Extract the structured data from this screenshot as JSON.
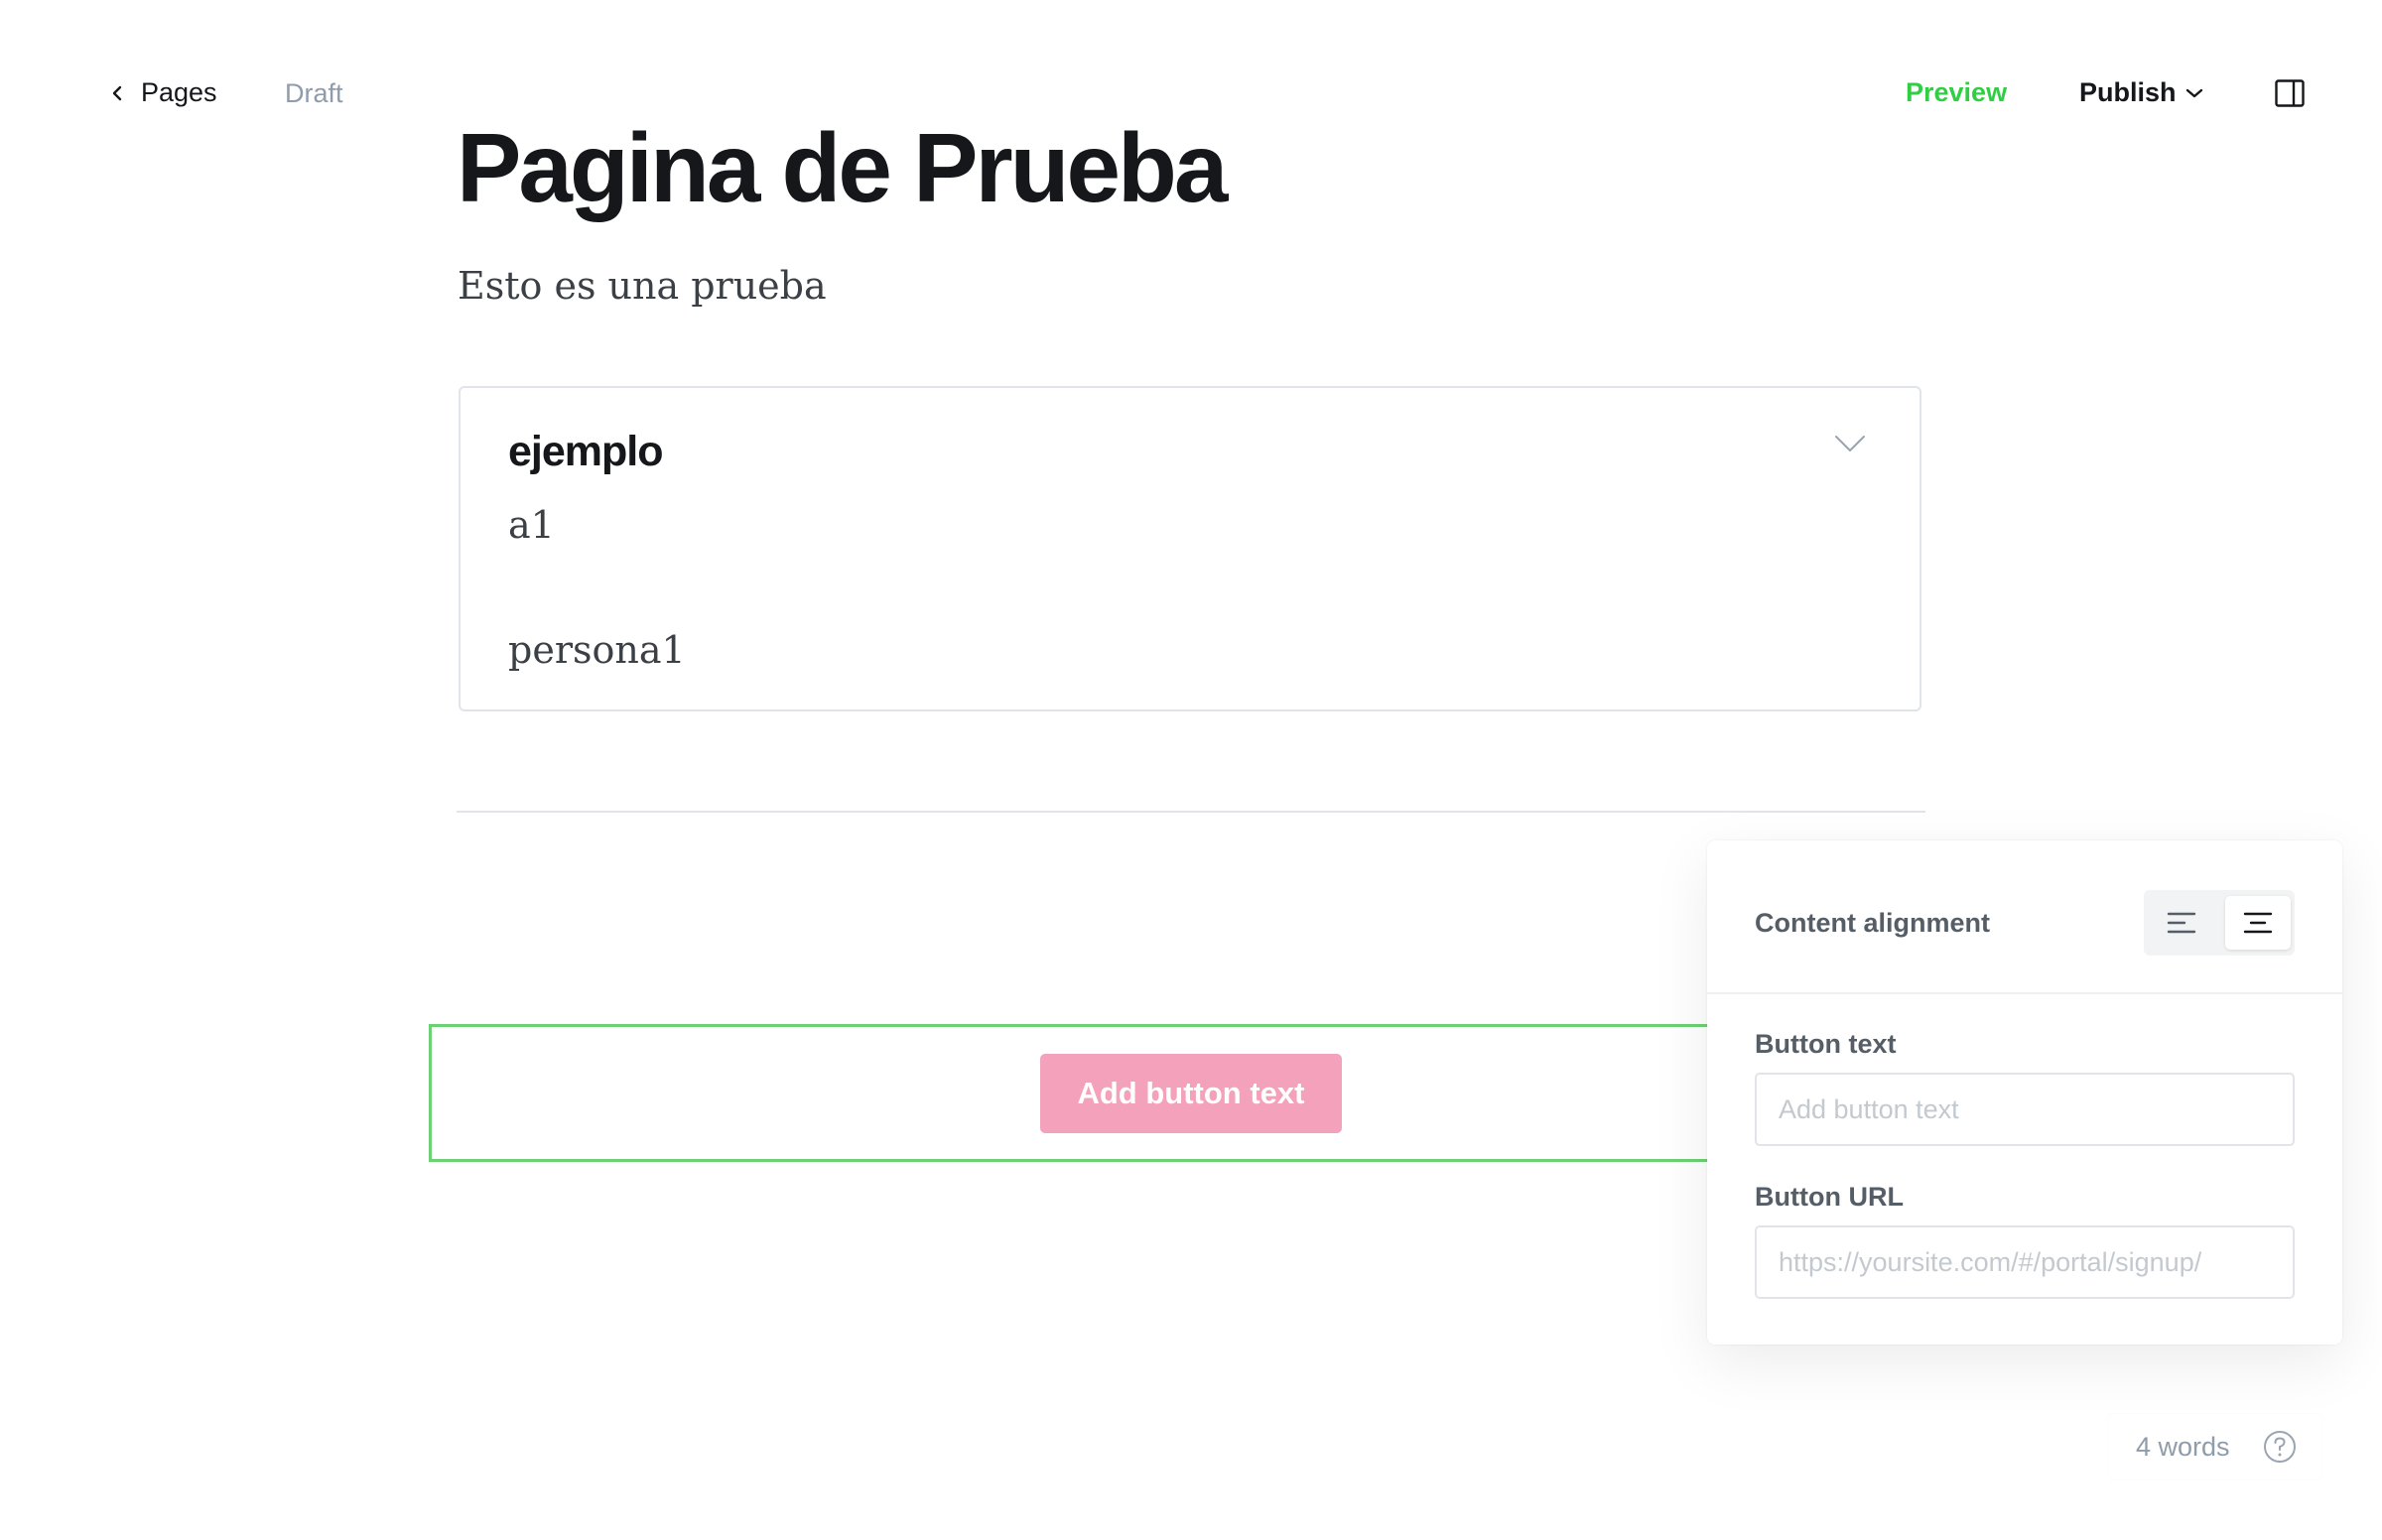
{
  "topbar": {
    "back_label": "Pages",
    "status": "Draft",
    "preview_label": "Preview",
    "publish_label": "Publish"
  },
  "post": {
    "title": "Pagina de Prueba",
    "excerpt": "Esto es una prueba"
  },
  "toggle_card": {
    "heading": "ejemplo",
    "lines": [
      "a1",
      "persona1"
    ]
  },
  "button_card": {
    "button_text": "Add button text"
  },
  "settings_panel": {
    "alignment_label": "Content alignment",
    "button_text_label": "Button text",
    "button_text_placeholder": "Add button text",
    "button_text_value": "",
    "button_url_label": "Button URL",
    "button_url_placeholder": "https://yoursite.com/#/portal/signup/",
    "button_url_value": ""
  },
  "word_count": {
    "label": "4 words"
  },
  "colors": {
    "accent_green": "#30cf43",
    "selection_border": "#6cd173",
    "button_pink": "#f4a1bb"
  },
  "icons": [
    "chevron-left-icon",
    "chevron-down-icon",
    "sidebar-toggle-icon",
    "align-left-icon",
    "align-center-icon",
    "help-icon"
  ]
}
